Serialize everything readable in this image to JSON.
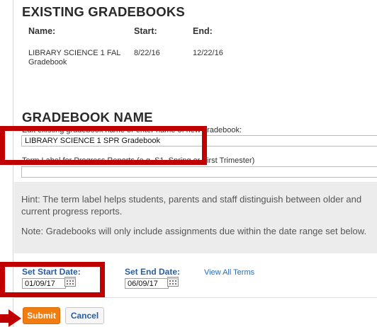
{
  "existing": {
    "title": "EXISTING GRADEBOOKS",
    "columns": [
      "Name:",
      "Start:",
      "End:"
    ],
    "rows": [
      {
        "name": "LIBRARY SCIENCE 1 FAL Gradebook",
        "start": "8/22/16",
        "end": "12/22/16"
      }
    ]
  },
  "gradebook_name": {
    "title": "GRADEBOOK NAME",
    "name_label": "Edit existing gradebook name or enter name of new gradebook:",
    "name_value": "LIBRARY SCIENCE 1 SPR Gradebook",
    "term_label": "Term Label for Progress Reports (e.g. S1, Spring or First Trimester)",
    "term_value": ""
  },
  "hint": {
    "text1": "Hint: The term label helps students, parents and staff distinguish between older and current progress reports.",
    "text2": "Note: Gradebooks will only include assignments due within the date range set below."
  },
  "dates": {
    "start_label": "Set Start Date:",
    "start_value": "01/09/17",
    "end_label": "Set End Date:",
    "end_value": "06/09/17",
    "view_all_link": "View All Terms"
  },
  "buttons": {
    "submit": "Submit",
    "cancel": "Cancel"
  },
  "colors": {
    "annotation_red": "#c00000",
    "submit_orange": "#f07d12",
    "link_blue": "#2b6cb0"
  },
  "icons": {
    "calendar": "calendar-icon",
    "arrow": "arrow-pointer-icon"
  }
}
